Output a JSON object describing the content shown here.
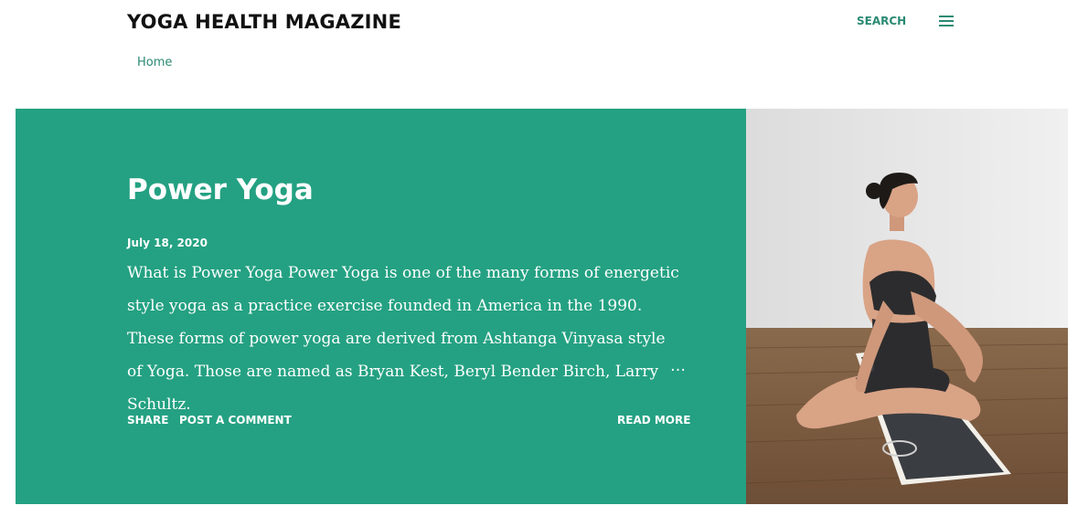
{
  "header": {
    "site_title": "YOGA HEALTH MAGAZINE",
    "search_label": "SEARCH",
    "menu_icon": "hamburger-menu-icon"
  },
  "nav": {
    "items": [
      {
        "label": "Home"
      }
    ]
  },
  "featured_post": {
    "title": "Power Yoga",
    "date": "July 18, 2020",
    "snippet": "What is Power Yoga Power Yoga is one of the many forms of energetic style yoga as a practice exercise founded in America in the 1990. These forms of power yoga are derived from Ashtanga Vinyasa style of Yoga. Those are named as Bryan Kest, Beryl Bender Birch, Larry Schultz.",
    "ellipsis": "…",
    "actions": {
      "share": "SHARE",
      "comment": "POST A COMMENT",
      "read_more": "READ MORE"
    },
    "image_subject": "woman-seated-yoga-twist-on-mat",
    "panel_color": "#24a182"
  },
  "colors": {
    "accent": "#2a8a73",
    "text_dark": "#111111",
    "panel": "#24a182"
  }
}
